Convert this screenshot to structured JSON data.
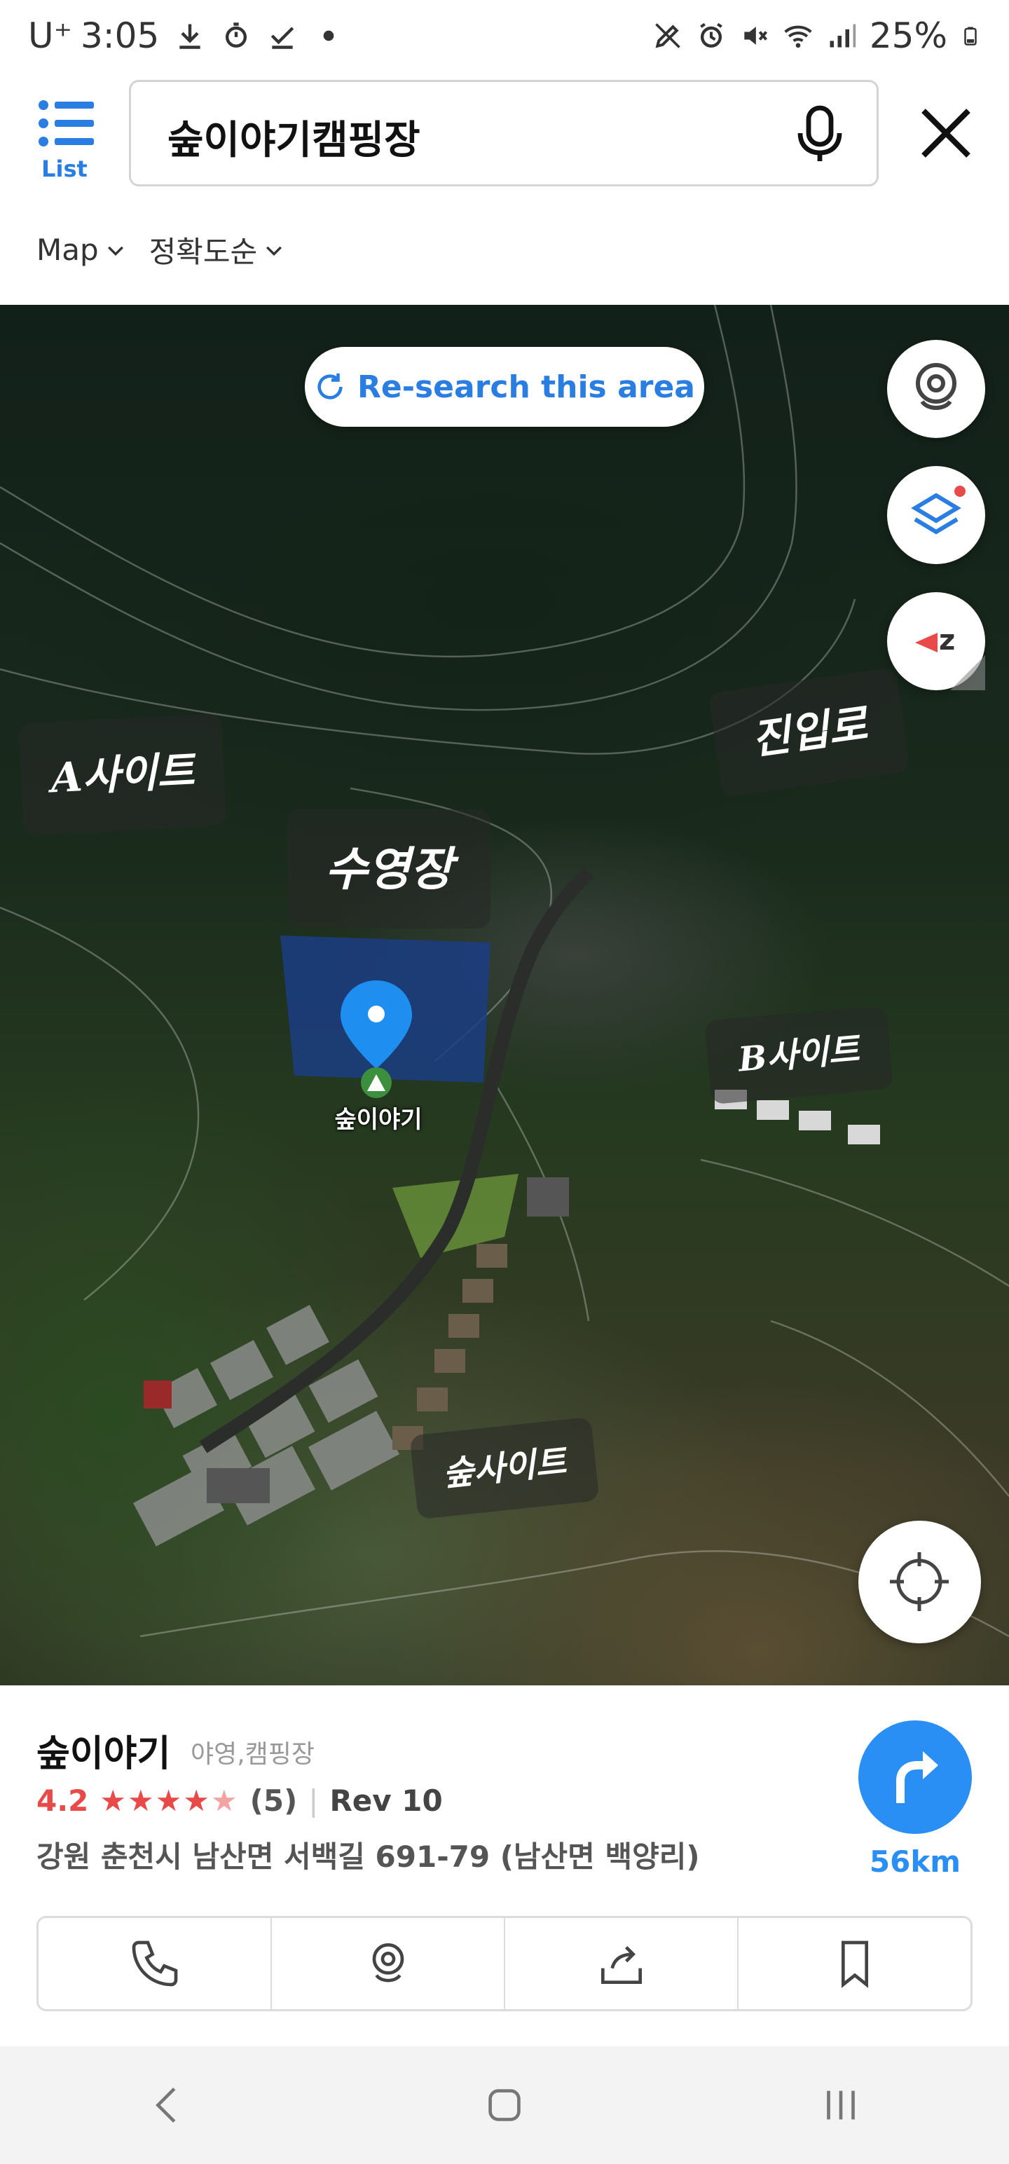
{
  "status_bar": {
    "carrier": "U⁺",
    "time": "3:05",
    "battery": "25%"
  },
  "header": {
    "list_label": "List",
    "search_query": "숲이야기캠핑장",
    "filters": [
      "Map",
      "정확도순"
    ]
  },
  "map": {
    "research_label": "Re-search this area",
    "pin_label": "숲이야기",
    "annotations": {
      "a_site": "A사이트",
      "pool": "수영장",
      "entrance": "진입로",
      "b_site": "B사이트",
      "forest_site": "숲사이트"
    },
    "buttons": [
      "roadview-icon",
      "layers-icon",
      "compass-icon",
      "my-location-icon"
    ]
  },
  "place": {
    "name": "숲이야기",
    "category": "야영,캠핑장",
    "rating": "4.2",
    "reviews": "(5)",
    "rev": "Rev 10",
    "address": "강원 춘천시 남산면 서백길 691-79 (남산면 백양리)",
    "distance": "56km"
  },
  "actions": [
    "phone-icon",
    "roadview-icon",
    "share-icon",
    "bookmark-icon"
  ],
  "colors": {
    "accent": "#2a7de1",
    "route": "#2a8ff5",
    "rating": "#e84a4a"
  }
}
